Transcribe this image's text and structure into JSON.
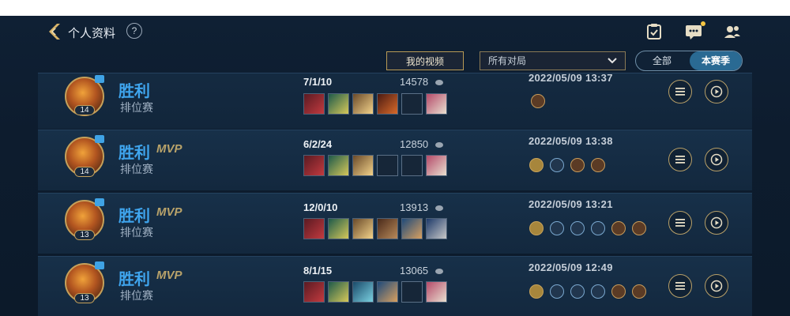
{
  "header": {
    "title": "个人资料",
    "help": "?"
  },
  "filters": {
    "my_videos": "我的视频",
    "match_select": "所有对局",
    "seg_all": "全部",
    "seg_season": "本赛季"
  },
  "rows": [
    {
      "result": "胜利",
      "mvp": "",
      "mode": "排位赛",
      "level": "14",
      "kda": "7/1/10",
      "score": "14578",
      "date": "2022/05/09 13:37",
      "badges": [
        "gold-badge"
      ]
    },
    {
      "result": "胜利",
      "mvp": "MVP",
      "mode": "排位赛",
      "level": "14",
      "kda": "6/2/24",
      "score": "12850",
      "date": "2022/05/09 13:38",
      "badges": [
        "mvp-s-badge",
        "flag-badge",
        "gold-badge",
        "gold-badge"
      ]
    },
    {
      "result": "胜利",
      "mvp": "MVP",
      "mode": "排位赛",
      "level": "13",
      "kda": "12/0/10",
      "score": "13913",
      "date": "2022/05/09 13:21",
      "badges": [
        "mvp-s-badge",
        "kill-badge",
        "assist-badge",
        "assist-badge",
        "gold-badge",
        "gold-badge"
      ]
    },
    {
      "result": "胜利",
      "mvp": "MVP",
      "mode": "排位赛",
      "level": "13",
      "kda": "8/1/15",
      "score": "13065",
      "date": "2022/05/09 12:49",
      "badges": [
        "mvp-s-badge",
        "flag-badge",
        "assist-badge",
        "assist-badge",
        "gold-badge",
        "gold-badge"
      ]
    }
  ],
  "colors": {
    "victory": "#3fa5ee",
    "gold": "#c8a35a",
    "background": "#0f2034"
  }
}
